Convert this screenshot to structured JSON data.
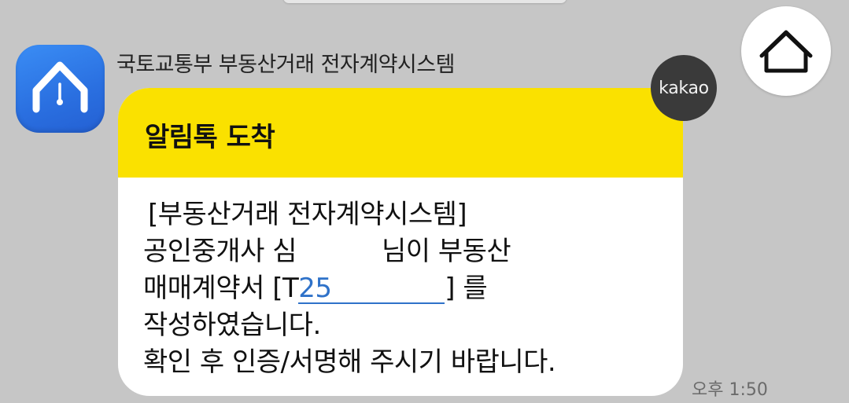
{
  "sender": {
    "name": "국토교통부 부동산거래 전자계약시스템",
    "avatar_icon": "house-clock-icon"
  },
  "message": {
    "title": "알림톡 도착",
    "lines": {
      "line1": "[부동산거래 전자계약시스템]",
      "line2_a": "공인중개사 심",
      "line2_b": "님이 부동산",
      "line3_a": "매매계약서 [T",
      "line3_link": "25",
      "line3_b": "] 를",
      "line4": "작성하였습니다.",
      "line5": "확인 후 인증/서명해 주시기 바랍니다."
    },
    "timestamp": "오후 1:50"
  },
  "badge": {
    "label": "kakao"
  },
  "home": {
    "icon": "home-icon"
  },
  "colors": {
    "background": "#c6c6c6",
    "header_yellow": "#fae100",
    "avatar_blue": "#2a6fe0",
    "link_blue": "#2f72c9",
    "badge_dark": "#3a3a3a"
  }
}
